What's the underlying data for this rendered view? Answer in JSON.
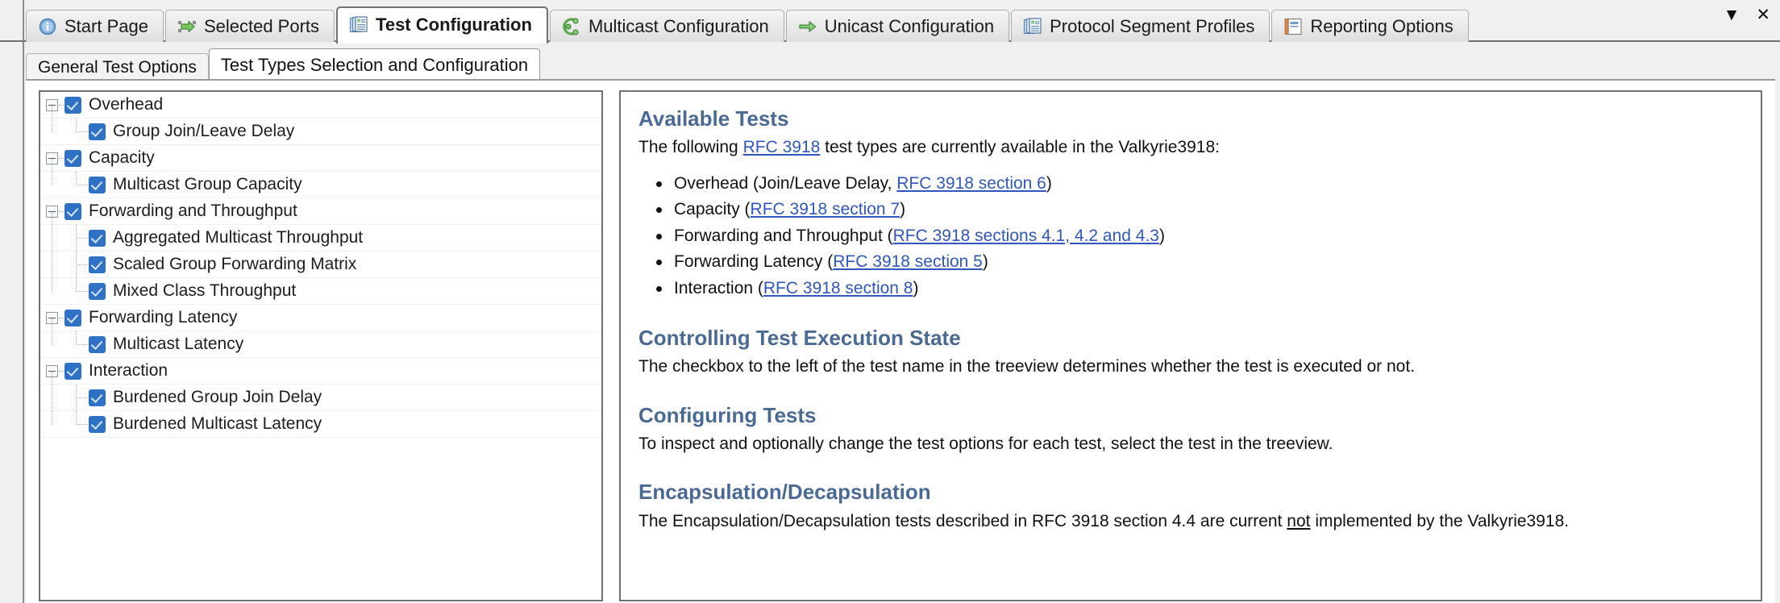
{
  "window": {
    "tabs": [
      {
        "label": "Start Page",
        "icon": "info-circle-icon",
        "active": false
      },
      {
        "label": "Selected Ports",
        "icon": "green-arrow-ports-icon",
        "active": false
      },
      {
        "label": "Test Configuration",
        "icon": "stacked-documents-icon",
        "active": true
      },
      {
        "label": "Multicast Configuration",
        "icon": "multicast-node-icon",
        "active": false
      },
      {
        "label": "Unicast Configuration",
        "icon": "green-arrow-icon",
        "active": false
      },
      {
        "label": "Protocol Segment Profiles",
        "icon": "stacked-documents-icon",
        "active": false
      },
      {
        "label": "Reporting Options",
        "icon": "notebook-icon",
        "active": false
      }
    ],
    "controls": {
      "dropdown": "▼",
      "close": "✕"
    }
  },
  "subtabs": [
    {
      "label": "General Test Options",
      "active": false
    },
    {
      "label": "Test Types Selection and Configuration",
      "active": true
    }
  ],
  "tree": {
    "nodes": [
      {
        "label": "Overhead",
        "level": 0,
        "checked": true,
        "expanded": true
      },
      {
        "label": "Group Join/Leave Delay",
        "level": 1,
        "checked": true,
        "last": true
      },
      {
        "label": "Capacity",
        "level": 0,
        "checked": true,
        "expanded": true
      },
      {
        "label": "Multicast Group Capacity",
        "level": 1,
        "checked": true,
        "last": true
      },
      {
        "label": "Forwarding and Throughput",
        "level": 0,
        "checked": true,
        "expanded": true
      },
      {
        "label": "Aggregated Multicast Throughput",
        "level": 1,
        "checked": true,
        "last": false
      },
      {
        "label": "Scaled Group Forwarding Matrix",
        "level": 1,
        "checked": true,
        "last": false
      },
      {
        "label": "Mixed Class Throughput",
        "level": 1,
        "checked": true,
        "last": true
      },
      {
        "label": "Forwarding Latency",
        "level": 0,
        "checked": true,
        "expanded": true
      },
      {
        "label": "Multicast Latency",
        "level": 1,
        "checked": true,
        "last": true
      },
      {
        "label": "Interaction",
        "level": 0,
        "checked": true,
        "expanded": true
      },
      {
        "label": "Burdened Group Join Delay",
        "level": 1,
        "checked": true,
        "last": false
      },
      {
        "label": "Burdened Multicast Latency",
        "level": 1,
        "checked": true,
        "last": true
      }
    ]
  },
  "help": {
    "available": {
      "heading": "Available Tests",
      "intro_before": "The following ",
      "intro_link": "RFC 3918",
      "intro_after": " test types are currently available in the Valkyrie3918:",
      "bullets": [
        {
          "text_before": "Overhead (Join/Leave Delay, ",
          "link": "RFC 3918 section 6",
          "text_after": ")"
        },
        {
          "text_before": "Capacity (",
          "link": "RFC 3918 section 7",
          "text_after": ")"
        },
        {
          "text_before": "Forwarding and Throughput (",
          "link": "RFC 3918 sections 4.1, 4.2 and 4.3",
          "text_after": ")"
        },
        {
          "text_before": "Forwarding Latency (",
          "link": "RFC 3918 section 5",
          "text_after": ")"
        },
        {
          "text_before": "Interaction (",
          "link": "RFC 3918 section 8",
          "text_after": ")"
        }
      ]
    },
    "execution": {
      "heading": "Controlling Test Execution State",
      "body": "The checkbox to the left of the test name in the treeview determines whether the test is executed or not."
    },
    "configuring": {
      "heading": "Configuring Tests",
      "body": "To inspect and optionally change the test options for each test, select the test in the treeview."
    },
    "encapsulation": {
      "heading": "Encapsulation/Decapsulation",
      "body_before": "The Encapsulation/Decapsulation tests described in RFC 3918 section 4.4 are current ",
      "body_underlined": "not",
      "body_after": " implemented by the Valkyrie3918."
    }
  },
  "colors": {
    "heading": "#4a6a95",
    "link": "#2f57bf",
    "checkbox": "#2f71c4",
    "border": "#6e7276"
  }
}
